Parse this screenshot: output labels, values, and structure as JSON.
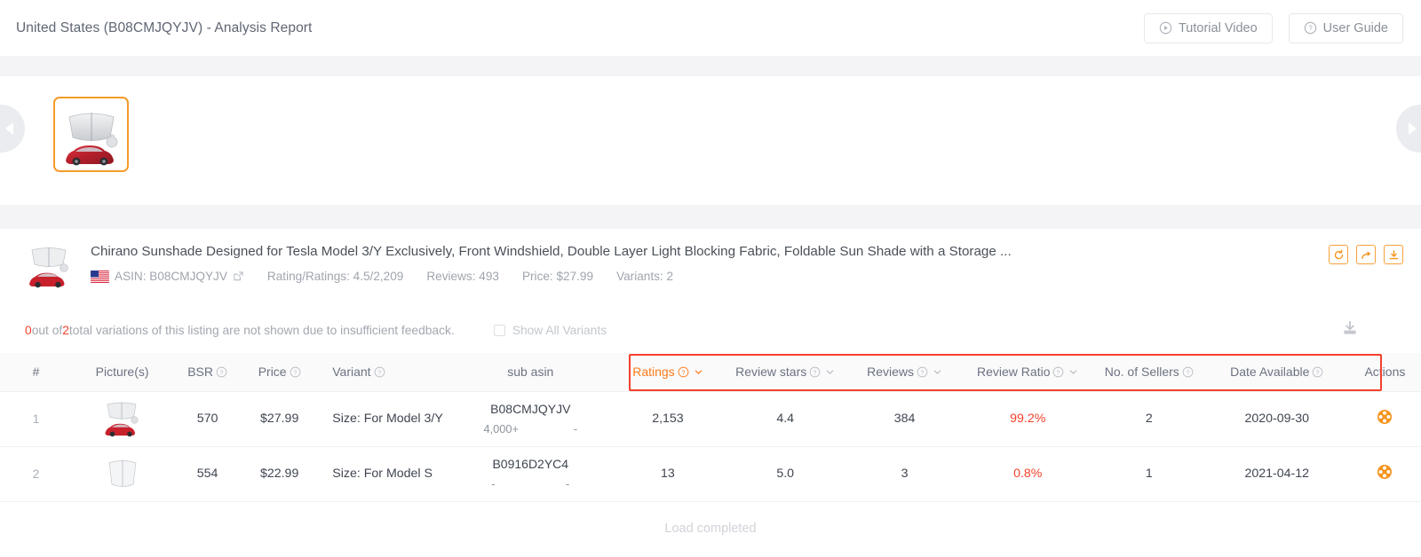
{
  "header": {
    "title": "United States (B08CMJQYJV) - Analysis Report",
    "tutorial_button": "Tutorial Video",
    "guide_button": "User Guide"
  },
  "gallery": {
    "prev_label": "Previous",
    "next_label": "Next",
    "selected_index": 1
  },
  "product": {
    "title": "Chirano Sunshade Designed for Tesla Model 3/Y Exclusively, Front Windshield, Double Layer Light Blocking Fabric, Foldable Sun Shade with a Storage ...",
    "asin": "ASIN: B08CMJQYJV",
    "rating": "Rating/Ratings: 4.5/2,209",
    "reviews": "Reviews: 493",
    "price": "Price: $27.99",
    "variants": "Variants: 2",
    "country": "United States"
  },
  "notice": {
    "shown": "0",
    "mid": " out of ",
    "total": "2",
    "tail": " total variations of this listing are not shown due to insufficient feedback.",
    "show_all_label": "Show All Variants",
    "show_all_checked": false
  },
  "table": {
    "columns": [
      {
        "label": "#",
        "help": false,
        "sort": false,
        "sorted": false
      },
      {
        "label": "Picture(s)",
        "help": false,
        "sort": false,
        "sorted": false
      },
      {
        "label": "BSR",
        "help": true,
        "sort": false,
        "sorted": false
      },
      {
        "label": "Price",
        "help": true,
        "sort": false,
        "sorted": false
      },
      {
        "label": "Variant",
        "help": true,
        "sort": false,
        "sorted": false
      },
      {
        "label": "sub asin",
        "help": false,
        "sort": false,
        "sorted": false
      },
      {
        "label": "Ratings",
        "help": true,
        "sort": true,
        "sorted": true
      },
      {
        "label": "Review stars",
        "help": true,
        "sort": true,
        "sorted": false
      },
      {
        "label": "Reviews",
        "help": true,
        "sort": true,
        "sorted": false
      },
      {
        "label": "Review Ratio",
        "help": true,
        "sort": true,
        "sorted": false
      },
      {
        "label": "No. of Sellers",
        "help": true,
        "sort": false,
        "sorted": false
      },
      {
        "label": "Date Available",
        "help": true,
        "sort": false,
        "sorted": false
      },
      {
        "label": "Actions",
        "help": false,
        "sort": false,
        "sorted": false
      }
    ],
    "rows": [
      {
        "index": "1",
        "bsr": "570",
        "price": "$27.99",
        "variant": "Size: For Model 3/Y",
        "sub_asin": "B08CMJQYJV",
        "sub_asin_left": "4,000+",
        "sub_asin_right": "-",
        "ratings": "2,153",
        "review_stars": "4.4",
        "reviews": "384",
        "review_ratio": "99.2%",
        "sellers": "2",
        "date_available": "2020-09-30",
        "thumb": "sunshade-with-car"
      },
      {
        "index": "2",
        "bsr": "554",
        "price": "$22.99",
        "variant": "Size: For Model S",
        "sub_asin": "B0916D2YC4",
        "sub_asin_left": "-",
        "sub_asin_right": "-",
        "ratings": "13",
        "review_stars": "5.0",
        "reviews": "3",
        "review_ratio": "0.8%",
        "sellers": "1",
        "date_available": "2021-04-12",
        "thumb": "sunshade-only"
      }
    ]
  },
  "footer": {
    "load_status": "Load completed"
  },
  "colors": {
    "accent_orange": "#ff7a18",
    "alert_red": "#f5402c",
    "text_primary": "#3f4550",
    "text_muted": "#a0a5ad",
    "band": "#f4f4f7"
  }
}
